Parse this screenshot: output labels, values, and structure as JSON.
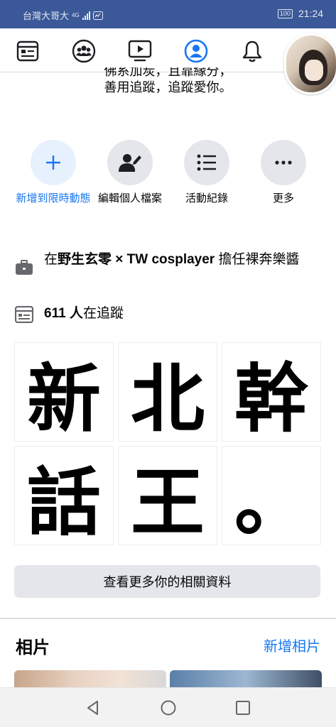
{
  "status_bar": {
    "carrier": "台灣大哥大",
    "network": "4G",
    "battery": "100",
    "time": "21:24"
  },
  "nav": {
    "tabs": [
      {
        "name": "news-feed",
        "icon": "news-feed-icon",
        "active": false
      },
      {
        "name": "groups",
        "icon": "groups-icon",
        "active": false
      },
      {
        "name": "watch",
        "icon": "watch-video-icon",
        "active": false
      },
      {
        "name": "profile",
        "icon": "profile-icon",
        "active": true
      },
      {
        "name": "notifications",
        "icon": "bell-icon",
        "active": false
      },
      {
        "name": "menu",
        "icon": "avatar-menu",
        "active": false
      }
    ]
  },
  "bio": {
    "line1": "佛系加炭，且靠緣分，",
    "line2": "善用追蹤，追蹤愛你。"
  },
  "actions": {
    "add_story": "新增到限時動態",
    "edit_profile": "編輯個人檔案",
    "activity_log": "活動紀錄",
    "more": "更多"
  },
  "info": {
    "work_prefix": "在",
    "work_place": "野生玄零 × TW cosplayer",
    "work_suffix": " 擔任裸奔樂醬",
    "followers_count": "611 人",
    "followers_suffix": "在追蹤"
  },
  "featured_grid": {
    "tiles": [
      "新",
      "北",
      "幹",
      "話",
      "王",
      "。"
    ]
  },
  "see_more_label": "查看更多你的相關資料",
  "photos": {
    "title": "相片",
    "add_label": "新增相片"
  },
  "colors": {
    "status_bar": "#3b5998",
    "accent_blue": "#1877f2",
    "button_grey": "#e4e6eb"
  }
}
